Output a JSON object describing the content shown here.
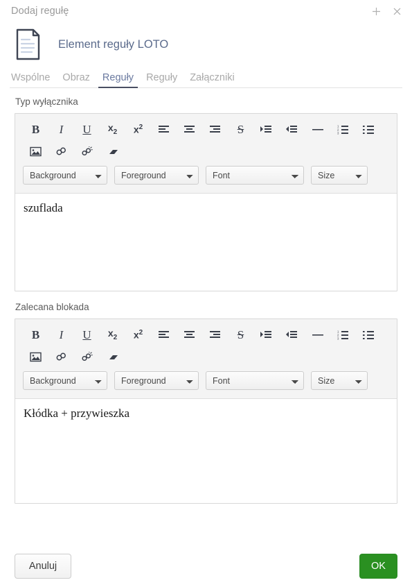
{
  "titlebar": {
    "title": "Dodaj regułę",
    "add_icon": "plus-icon",
    "close_icon": "close-icon"
  },
  "header": {
    "icon": "document-icon",
    "title": "Element reguły LOTO"
  },
  "tabs": [
    {
      "label": "Wspólne",
      "active": false
    },
    {
      "label": "Obraz",
      "active": false
    },
    {
      "label": "Reguły",
      "active": true
    },
    {
      "label": "Reguły",
      "active": false
    },
    {
      "label": "Załączniki",
      "active": false
    }
  ],
  "toolbar": {
    "buttons_row1": [
      {
        "name": "bold-icon",
        "label": "B"
      },
      {
        "name": "italic-icon",
        "label": "I"
      },
      {
        "name": "underline-icon",
        "label": "U"
      },
      {
        "name": "subscript-icon",
        "label": "x2"
      },
      {
        "name": "superscript-icon",
        "label": "x2"
      },
      {
        "name": "align-left-icon",
        "label": ""
      },
      {
        "name": "align-center-icon",
        "label": ""
      },
      {
        "name": "align-right-icon",
        "label": ""
      },
      {
        "name": "strikethrough-icon",
        "label": "S"
      },
      {
        "name": "indent-increase-icon",
        "label": ""
      },
      {
        "name": "indent-decrease-icon",
        "label": ""
      },
      {
        "name": "horizontal-rule-icon",
        "label": ""
      },
      {
        "name": "ordered-list-icon",
        "label": ""
      },
      {
        "name": "unordered-list-icon",
        "label": ""
      }
    ],
    "buttons_row2": [
      {
        "name": "insert-image-icon",
        "label": ""
      },
      {
        "name": "insert-link-icon",
        "label": ""
      },
      {
        "name": "unlink-icon",
        "label": ""
      },
      {
        "name": "eraser-icon",
        "label": ""
      }
    ],
    "selects": {
      "background": "Background",
      "foreground": "Foreground",
      "font": "Font",
      "size": "Size"
    }
  },
  "fields": [
    {
      "label": "Typ wyłącznika",
      "value": "szuflada"
    },
    {
      "label": "Zalecana blokada",
      "value": "Kłódka + przywieszka"
    }
  ],
  "footer": {
    "cancel_label": "Anuluj",
    "ok_label": "OK"
  },
  "colors": {
    "ok_button": "#2a9021",
    "tab_active_underline": "#4a4f63",
    "header_title": "#5b6b8c",
    "toolbar_bg": "#f4f4f4"
  }
}
